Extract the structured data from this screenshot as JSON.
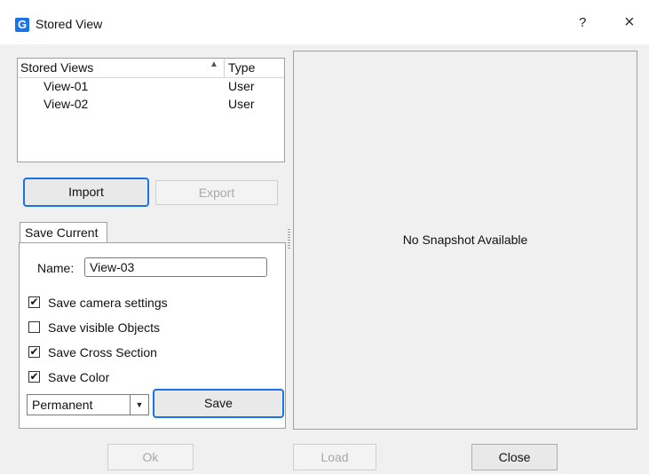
{
  "window": {
    "title": "Stored View",
    "app_icon_letter": "G",
    "help_label": "?",
    "close_label": "×"
  },
  "views_table": {
    "columns": [
      "Stored Views",
      "Type"
    ],
    "sort_indicator": "▲",
    "rows": [
      {
        "name": "View-01",
        "type": "User"
      },
      {
        "name": "View-02",
        "type": "User"
      }
    ]
  },
  "buttons": {
    "import": "Import",
    "export": "Export",
    "save": "Save",
    "ok": "Ok",
    "load": "Load",
    "close": "Close"
  },
  "save_current": {
    "tab_label": "Save Current",
    "name_label": "Name:",
    "name_value": "View-03",
    "options": [
      {
        "label": "Save camera settings",
        "checked": true
      },
      {
        "label": "Save visible Objects",
        "checked": false
      },
      {
        "label": "Save Cross Section",
        "checked": true
      },
      {
        "label": "Save Color",
        "checked": true
      }
    ],
    "persistence_selected": "Permanent"
  },
  "preview": {
    "text": "No Snapshot Available"
  },
  "colors": {
    "accent": "#1a73e8",
    "dialog_bg": "#f0f0f0"
  },
  "icons": {
    "app": "app-logo-icon",
    "help": "help-icon",
    "close": "close-icon",
    "sort": "sort-ascending-icon",
    "dropdown": "chevron-down-icon",
    "check": "check-icon"
  }
}
